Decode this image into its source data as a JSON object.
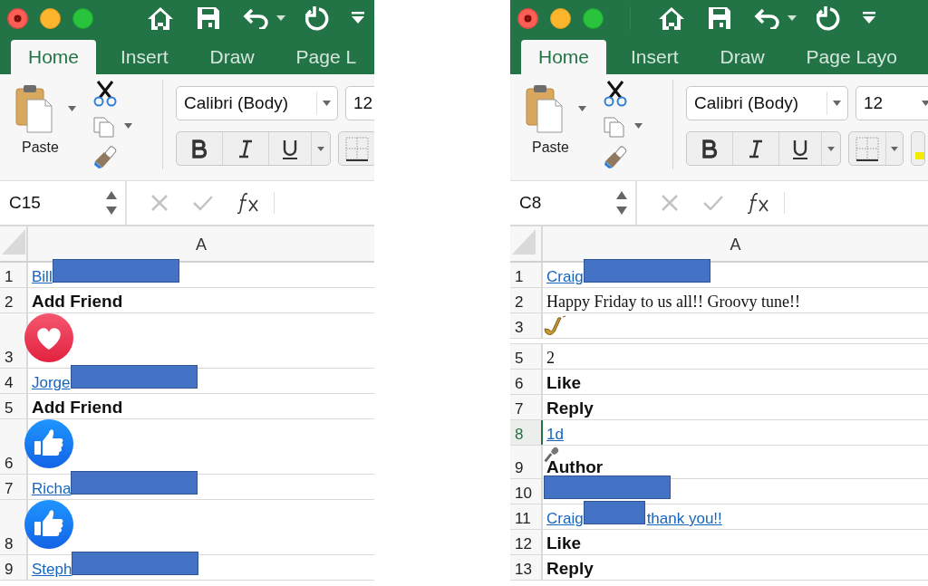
{
  "panels": [
    {
      "tabs": [
        {
          "label": "Home",
          "selected": true
        },
        {
          "label": "Insert",
          "selected": false
        },
        {
          "label": "Draw",
          "selected": false
        },
        {
          "label": "Page L",
          "selected": false
        }
      ],
      "font_name": "Calibri (Body)",
      "font_size": "12",
      "paste_label": "Paste",
      "name_box": "C15",
      "column_header": "A",
      "rows": [
        {
          "number": "1",
          "selected": false,
          "cell": {
            "kind": "link",
            "text": "Bill",
            "redacted": true
          }
        },
        {
          "number": "2",
          "selected": false,
          "cell": {
            "kind": "bold",
            "text": "Add Friend"
          }
        },
        {
          "number": "3",
          "selected": false,
          "cell": {
            "kind": "heart"
          }
        },
        {
          "number": "4",
          "selected": false,
          "cell": {
            "kind": "link",
            "text": "Jorge",
            "redacted": true
          }
        },
        {
          "number": "5",
          "selected": false,
          "cell": {
            "kind": "bold",
            "text": "Add Friend"
          }
        },
        {
          "number": "6",
          "selected": false,
          "cell": {
            "kind": "like"
          }
        },
        {
          "number": "7",
          "selected": false,
          "cell": {
            "kind": "link",
            "text": "Richa",
            "redacted": true
          }
        },
        {
          "number": "8",
          "selected": false,
          "cell": {
            "kind": "like"
          }
        },
        {
          "number": "9",
          "selected": false,
          "cell": {
            "kind": "link",
            "text": "Steph",
            "redacted": true
          }
        }
      ]
    },
    {
      "tabs": [
        {
          "label": "Home",
          "selected": true
        },
        {
          "label": "Insert",
          "selected": false
        },
        {
          "label": "Draw",
          "selected": false
        },
        {
          "label": "Page Layo",
          "selected": false
        }
      ],
      "font_name": "Calibri (Body)",
      "font_size": "12",
      "paste_label": "Paste",
      "name_box": "C8",
      "column_header": "A",
      "rows": [
        {
          "number": "1",
          "selected": false,
          "cell": {
            "kind": "link",
            "text": "Craig",
            "redacted": true
          }
        },
        {
          "number": "2",
          "selected": false,
          "cell": {
            "kind": "plain",
            "text": "Happy Friday to us all!! Groovy tune!!"
          }
        },
        {
          "number": "3",
          "selected": false,
          "cell": {
            "kind": "saxophone"
          }
        },
        {
          "kind": "hidden"
        },
        {
          "number": "5",
          "selected": false,
          "cell": {
            "kind": "plain",
            "text": "2"
          }
        },
        {
          "number": "6",
          "selected": false,
          "cell": {
            "kind": "bold",
            "text": "Like"
          }
        },
        {
          "number": "7",
          "selected": false,
          "cell": {
            "kind": "bold",
            "text": "Reply"
          }
        },
        {
          "number": "8",
          "selected": true,
          "cell": {
            "kind": "link",
            "text": "1d"
          }
        },
        {
          "number": "9",
          "selected": false,
          "cell": {
            "kind": "bold",
            "text": "Author",
            "has_icon": true
          }
        },
        {
          "number": "10",
          "selected": false,
          "cell": {
            "kind": "redaction"
          }
        },
        {
          "number": "11",
          "selected": false,
          "cell": {
            "kind": "link",
            "text": "Craig",
            "redacted": true,
            "text_after": "thank you!!"
          }
        },
        {
          "number": "12",
          "selected": false,
          "cell": {
            "kind": "bold",
            "text": "Like"
          }
        },
        {
          "number": "13",
          "selected": false,
          "cell": {
            "kind": "bold",
            "text": "Reply"
          }
        }
      ]
    }
  ]
}
